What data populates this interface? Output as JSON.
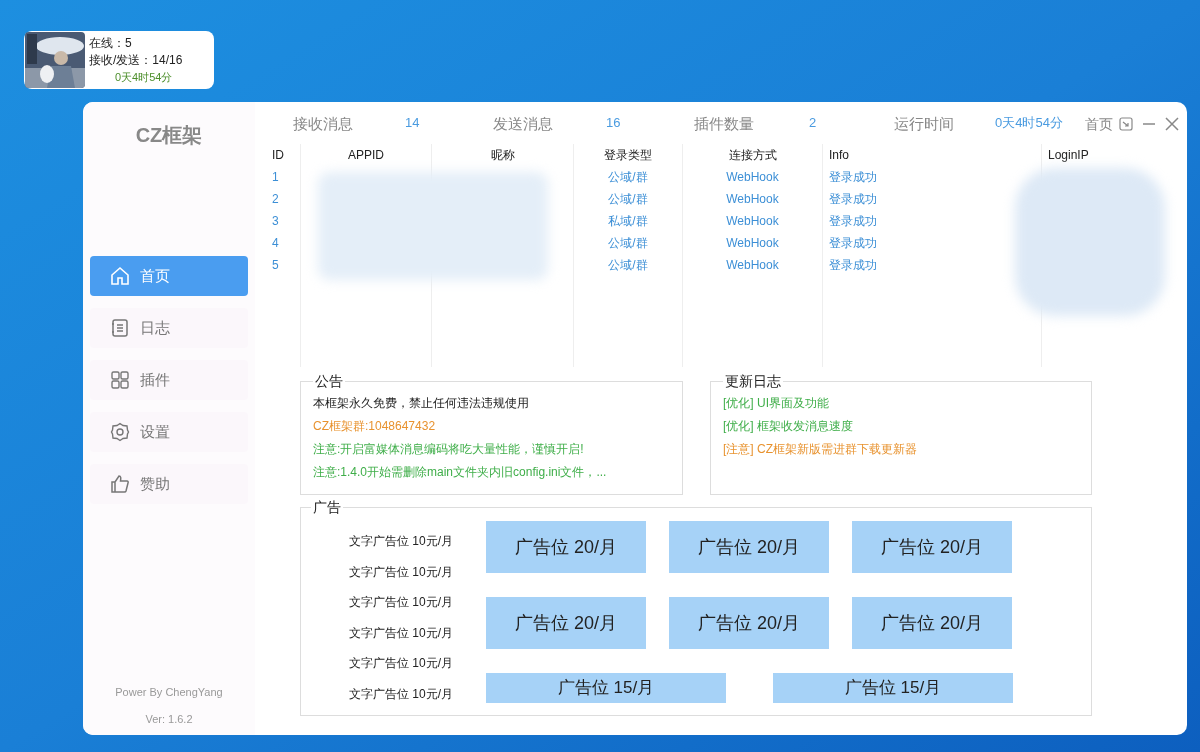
{
  "status_widget": {
    "online": "在线：5",
    "traffic": "接收/发送：14/16",
    "uptime": "0天4时54分"
  },
  "window": {
    "logo": "CZ框架",
    "title": "首页",
    "sidebar": {
      "items": [
        {
          "label": "首页",
          "kind": "home",
          "selected": true
        },
        {
          "label": "日志",
          "kind": "log",
          "selected": false
        },
        {
          "label": "插件",
          "kind": "plugins",
          "selected": false
        },
        {
          "label": "设置",
          "kind": "settings",
          "selected": false
        },
        {
          "label": "赞助",
          "kind": "sponsor",
          "selected": false
        }
      ],
      "footer": "Power By ChengYang",
      "version": "Ver: 1.6.2"
    },
    "stats": [
      {
        "label": "接收消息",
        "value": "14"
      },
      {
        "label": "发送消息",
        "value": "16"
      },
      {
        "label": "插件数量",
        "value": "2"
      },
      {
        "label": "运行时间",
        "value": "0天4时54分"
      }
    ],
    "table": {
      "columns": [
        "ID",
        "APPID",
        "昵称",
        "登录类型",
        "连接方式",
        "Info",
        "LoginIP"
      ],
      "rows": [
        {
          "id": "1",
          "login_type": "公域/群",
          "connection": "WebHook",
          "info": "登录成功"
        },
        {
          "id": "2",
          "login_type": "公域/群",
          "connection": "WebHook",
          "info": "登录成功"
        },
        {
          "id": "3",
          "login_type": "私域/群",
          "connection": "WebHook",
          "info": "登录成功"
        },
        {
          "id": "4",
          "login_type": "公域/群",
          "connection": "WebHook",
          "info": "登录成功"
        },
        {
          "id": "5",
          "login_type": "公域/群",
          "connection": "WebHook",
          "info": "登录成功"
        }
      ]
    },
    "notice": {
      "title": "公告",
      "lines": [
        {
          "text": "本框架永久免费，禁止任何违法违规使用",
          "color": "#222222"
        },
        {
          "text": "CZ框架群:1048647432",
          "color": "#e8922e"
        },
        {
          "text": "注意:开启富媒体消息编码将吃大量性能，谨慎开启!",
          "color": "#3fae49"
        },
        {
          "text": "注意:1.4.0开始需删除main文件夹内旧config.ini文件，...",
          "color": "#3fae49"
        }
      ]
    },
    "changelog": {
      "title": "更新日志",
      "lines": [
        {
          "text": "[优化] UI界面及功能",
          "color": "#3fae49"
        },
        {
          "text": "[优化] 框架收发消息速度",
          "color": "#3fae49"
        },
        {
          "text": "[注意] CZ框架新版需进群下载更新器",
          "color": "#e8922e"
        }
      ]
    },
    "ads": {
      "title": "广告",
      "text_ads": [
        "文字广告位 10元/月",
        "文字广告位 10元/月",
        "文字广告位 10元/月",
        "文字广告位 10元/月",
        "文字广告位 10元/月",
        "文字广告位 10元/月"
      ],
      "banners": [
        {
          "text": "广告位 20/月",
          "kind": "large"
        },
        {
          "text": "广告位 20/月",
          "kind": "large"
        },
        {
          "text": "广告位 20/月",
          "kind": "large"
        },
        {
          "text": "广告位 20/月",
          "kind": "large"
        },
        {
          "text": "广告位 20/月",
          "kind": "large"
        },
        {
          "text": "广告位 20/月",
          "kind": "large"
        },
        {
          "text": "广告位 15/月",
          "kind": "wide"
        },
        {
          "text": "广告位 15/月",
          "kind": "wide"
        }
      ]
    }
  }
}
